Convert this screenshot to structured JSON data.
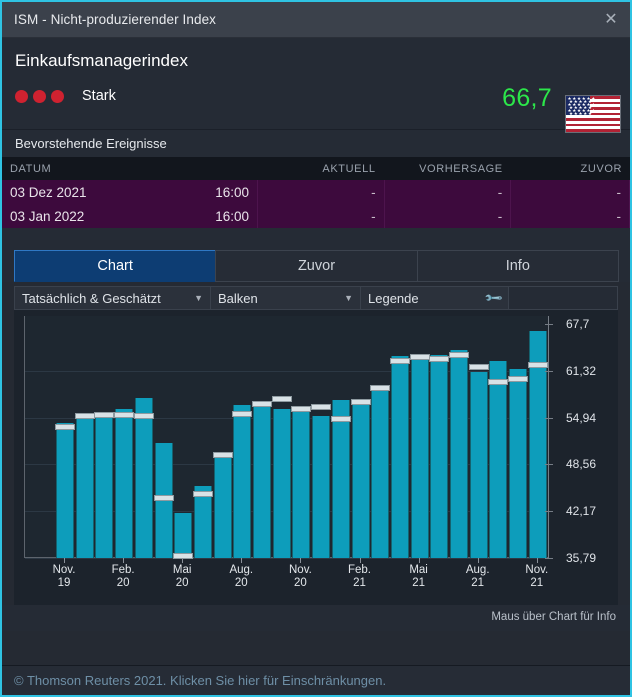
{
  "window": {
    "title": "ISM - Nicht-produzierender Index",
    "close_icon": "close-icon"
  },
  "header": {
    "index_name": "Einkaufsmanagerindex",
    "strength_label": "Stark",
    "strength_dots": 3,
    "value": "66,7",
    "value_color": "#2ce64a",
    "dot_color": "#cf2230",
    "flag": "us-flag-icon"
  },
  "events": {
    "section_title": "Bevorstehende Ereignisse",
    "columns": [
      "DATUM",
      "AKTUELL",
      "VORHERSAGE",
      "ZUVOR"
    ],
    "rows": [
      {
        "date": "03 Dez 2021",
        "time": "16:00",
        "actual": "-",
        "forecast": "-",
        "previous": "-"
      },
      {
        "date": "03 Jan 2022",
        "time": "16:00",
        "actual": "-",
        "forecast": "-",
        "previous": "-"
      }
    ],
    "row_color": "#3d0a3d"
  },
  "tabs": [
    {
      "label": "Chart",
      "active": true
    },
    {
      "label": "Zuvor",
      "active": false
    },
    {
      "label": "Info",
      "active": false
    }
  ],
  "controls": {
    "series": {
      "value": "Tatsächlich & Geschätzt",
      "arrow": "chevron-down-icon"
    },
    "type": {
      "value": "Balken",
      "arrow": "chevron-down-icon"
    },
    "legend": {
      "value": "Legende",
      "icon": "wrench-icon"
    }
  },
  "chart_hint": "Maus über Chart für Info",
  "footer": {
    "text": "© Thomson Reuters 2021. Klicken Sie hier für Einschränkungen."
  },
  "chart_data": {
    "type": "bar",
    "title": "",
    "xlabel": "",
    "ylabel": "",
    "ylim": [
      35.79,
      67.7
    ],
    "grid": true,
    "legend_position": "hidden",
    "ytick_labels": [
      "67,7",
      "61,32",
      "54,94",
      "48,56",
      "42,17",
      "35,79"
    ],
    "ytick_values": [
      67.7,
      61.32,
      54.94,
      48.56,
      42.17,
      35.79
    ],
    "xtick_labels": [
      "Nov.\n19",
      "Feb.\n20",
      "Mai\n20",
      "Aug.\n20",
      "Nov.\n20",
      "Feb.\n21",
      "Mai\n21",
      "Aug.\n21",
      "Nov.\n21"
    ],
    "xtick_indices": [
      0,
      3,
      6,
      9,
      12,
      15,
      18,
      21,
      24
    ],
    "categories": [
      "Nov. 19",
      "Dez. 19",
      "Jan. 20",
      "Feb. 20",
      "Mär. 20",
      "Apr. 20",
      "Mai 20",
      "Jun. 20",
      "Jul. 20",
      "Aug. 20",
      "Sep. 20",
      "Okt. 20",
      "Nov. 20",
      "Dez. 20",
      "Jan. 21",
      "Feb. 21",
      "Mär. 21",
      "Apr. 21",
      "Mai 21",
      "Jun. 21",
      "Jul. 21",
      "Aug. 21",
      "Sep. 21",
      "Okt. 21",
      "Nov. 21"
    ],
    "series": [
      {
        "name": "Tatsächlich",
        "color": "#0d9dbb",
        "values": [
          54.2,
          54.7,
          55.1,
          56.1,
          57.6,
          51.5,
          41.9,
          45.6,
          50.0,
          56.6,
          57.2,
          56.1,
          55.8,
          55.2,
          57.3,
          57.2,
          58.5,
          63.4,
          62.9,
          63.5,
          64.2,
          61.1,
          62.6,
          61.5,
          66.7
        ]
      },
      {
        "name": "Geschätzt",
        "color": "#d9e2e6",
        "values": [
          53.6,
          55.2,
          55.3,
          55.3,
          55.1,
          44.0,
          36.0,
          44.5,
          49.8,
          55.4,
          56.8,
          57.5,
          56.1,
          56.4,
          54.8,
          57.0,
          59.0,
          62.6,
          63.2,
          62.9,
          63.5,
          61.9,
          59.8,
          60.2,
          62.1
        ]
      }
    ]
  }
}
